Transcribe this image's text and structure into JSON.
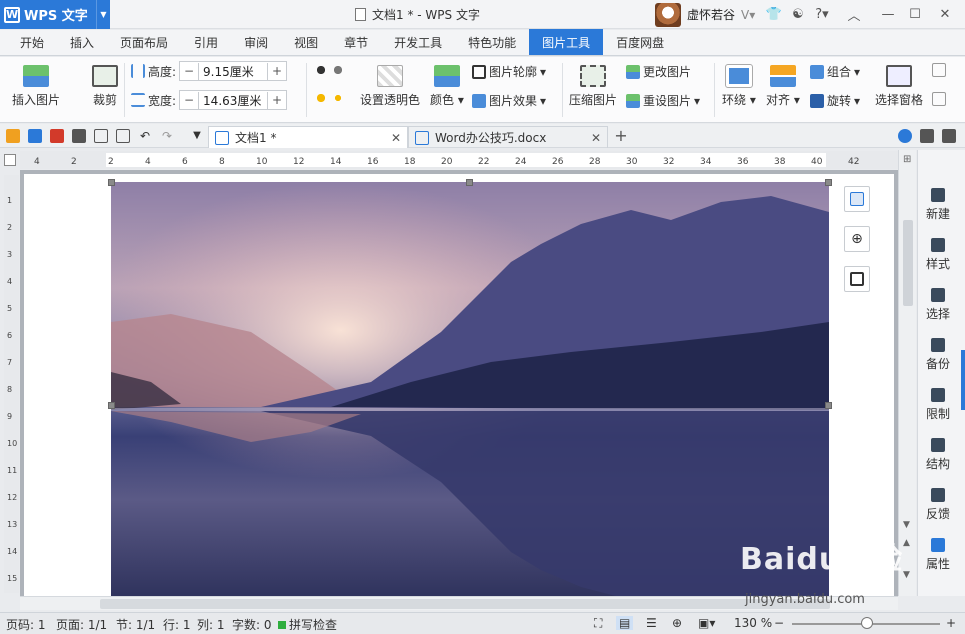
{
  "app": {
    "name": "WPS 文字",
    "window_title": "文档1 * - WPS 文字",
    "user_name": "虚怀若谷"
  },
  "menu_tabs": [
    "开始",
    "插入",
    "页面布局",
    "引用",
    "审阅",
    "视图",
    "章节",
    "开发工具",
    "特色功能",
    "图片工具",
    "百度网盘"
  ],
  "active_menu_tab": "图片工具",
  "ribbon": {
    "insert_image": "插入图片",
    "crop": "裁剪",
    "height_label": "高度:",
    "height_value": "9.15厘米",
    "width_label": "宽度:",
    "width_value": "14.63厘米",
    "set_transparent": "设置透明色",
    "color": "颜色",
    "outline": "图片轮廓",
    "effect": "图片效果",
    "compress": "压缩图片",
    "change": "更改图片",
    "reset": "重设图片",
    "wrap": "环绕",
    "align": "对齐",
    "group": "组合",
    "rotate": "旋转",
    "selection_pane": "选择窗格"
  },
  "doc_tabs": [
    {
      "title": "文档1 *",
      "active": true
    },
    {
      "title": "Word办公技巧.docx",
      "active": false
    }
  ],
  "ruler": {
    "h_ticks": [
      "4",
      "2",
      "2",
      "4",
      "6",
      "8",
      "10",
      "12",
      "14",
      "16",
      "18",
      "20",
      "22",
      "24",
      "26",
      "28",
      "30",
      "32",
      "34",
      "36",
      "38",
      "40",
      "42"
    ],
    "v_ticks": [
      "1",
      "2",
      "3",
      "4",
      "5",
      "6",
      "7",
      "8",
      "9",
      "10",
      "11",
      "12",
      "13",
      "14",
      "15"
    ]
  },
  "side_panel": [
    "新建",
    "样式",
    "选择",
    "备份",
    "限制",
    "结构",
    "反馈",
    "属性"
  ],
  "status": {
    "page_num": "页码: 1",
    "pages": "页面: 1/1",
    "section": "节: 1/1",
    "row": "行: 1",
    "col": "列: 1",
    "word_count": "字数: 0",
    "spell_check": "拼写检查",
    "zoom": "130 %"
  },
  "watermark": {
    "main": "Baidu经验",
    "sub": "jingyan.baidu.com"
  },
  "colors": {
    "accent": "#2b79d8"
  }
}
